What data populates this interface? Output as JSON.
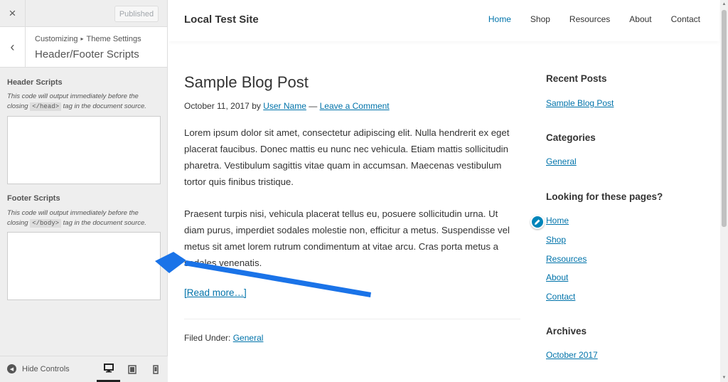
{
  "sidebar": {
    "close_label": "×",
    "published_label": "Published",
    "back_label": "‹",
    "breadcrumb_root": "Customizing",
    "breadcrumb_sep": "▸",
    "breadcrumb_parent": "Theme Settings",
    "section_title": "Header/Footer Scripts",
    "header_scripts": {
      "title": "Header Scripts",
      "desc_before": "This code will output immediately before the closing",
      "tag": "</head>",
      "desc_after": "tag in the document source.",
      "value": ""
    },
    "footer_scripts": {
      "title": "Footer Scripts",
      "desc_before": "This code will output immediately before the closing",
      "tag": "</body>",
      "desc_after": "tag in the document source.",
      "value": ""
    },
    "hide_controls_label": "Hide Controls"
  },
  "preview": {
    "site_title": "Local Test Site",
    "nav": [
      "Home",
      "Shop",
      "Resources",
      "About",
      "Contact"
    ],
    "post": {
      "title": "Sample Blog Post",
      "date": "October 11, 2017",
      "by": "by",
      "author": "User Name",
      "dash": "—",
      "comment_link": "Leave a Comment",
      "para1_lines": [
        "Lorem ipsum dolor sit amet, consectetur adipiscing elit. Nulla hendrerit ex eget",
        "placerat faucibus. Donec mattis eu nunc nec vehicula. Etiam mattis sollicitudin",
        "pharetra. Vestibulum sagittis vitae quam in accumsan. Maecenas vestibulum",
        "tortor quis finibus tristique."
      ],
      "para2_lines": [
        "Praesent turpis nisi, vehicula placerat tellus eu, posuere sollicitudin urna. Ut",
        "diam purus, imperdiet sodales molestie non, efficitur a metus. Suspendisse vel",
        "metus sit amet lorem rutrum condimentum at vitae arcu. Cras porta metus a",
        "sodales venenatis."
      ],
      "read_more": "[Read more…]",
      "filed_under_label": "Filed Under:",
      "category": "General"
    },
    "widgets": {
      "recent_posts_title": "Recent Posts",
      "recent_post": "Sample Blog Post",
      "categories_title": "Categories",
      "category": "General",
      "pages_title": "Looking for these pages?",
      "pages": [
        "Home",
        "Shop",
        "Resources",
        "About",
        "Contact"
      ],
      "archives_title": "Archives",
      "archive": "October 2017"
    }
  },
  "colors": {
    "link": "#0073aa",
    "arrow": "#1a73e8",
    "sidebar_bg": "#eeeeee",
    "edit_shortcut": "#0085ba"
  },
  "icons": {
    "close": "close-icon",
    "back": "chevron-left-icon",
    "hide_controls": "collapse-icon",
    "desktop": "desktop-icon",
    "tablet": "tablet-icon",
    "mobile": "mobile-icon",
    "edit": "pencil-icon"
  }
}
